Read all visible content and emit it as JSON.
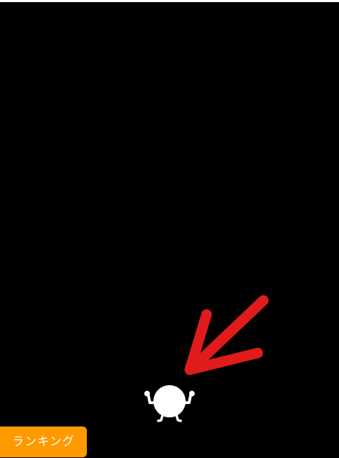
{
  "game": {
    "background_color": "#000000",
    "hint_arrow_color": "#e01b1b",
    "character_color": "#ffffff",
    "character_icon": "round-creature-arms-raised-icon",
    "hint_icon": "down-left-arrow-icon"
  },
  "ranking_button": {
    "label": "ランキング",
    "color": "#ff9900"
  }
}
